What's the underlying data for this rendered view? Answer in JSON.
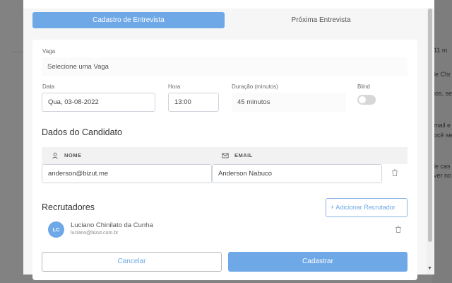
{
  "background": {
    "snippets": [
      "11 m",
      "le Chr",
      "ios, se",
      "mail e",
      "ocê se",
      "le cas",
      "ver no"
    ]
  },
  "tabs": [
    {
      "label": "Cadastro de Entrevista",
      "active": true
    },
    {
      "label": "Próxima Entrevista",
      "active": false
    }
  ],
  "form": {
    "vaga_label": "Vaga",
    "vaga_placeholder": "Selecione uma Vaga",
    "data_label": "Data",
    "data_value": "Qua, 03-08-2022",
    "hora_label": "Hora",
    "hora_value": "13:00",
    "duracao_label": "Duração (minutos)",
    "duracao_value": "45 minutos",
    "blind_label": "Blind",
    "blind_on": false
  },
  "candidato": {
    "title": "Dados do Candidato",
    "col_nome": "NOME",
    "col_email": "EMAIL",
    "row": {
      "nome": "anderson@bizut.me",
      "email": "Anderson Nabuco"
    }
  },
  "recrutadores": {
    "title": "Recrutadores",
    "add_label": "+ Adicionar Recrutador",
    "items": [
      {
        "initials": "LC",
        "name": "Luciano Chinilato da Cunha",
        "email": "luciano@bizut.com.br"
      }
    ]
  },
  "actions": {
    "cancel": "Cancelar",
    "submit": "Cadastrar"
  },
  "colors": {
    "accent": "#6ea8e6"
  }
}
